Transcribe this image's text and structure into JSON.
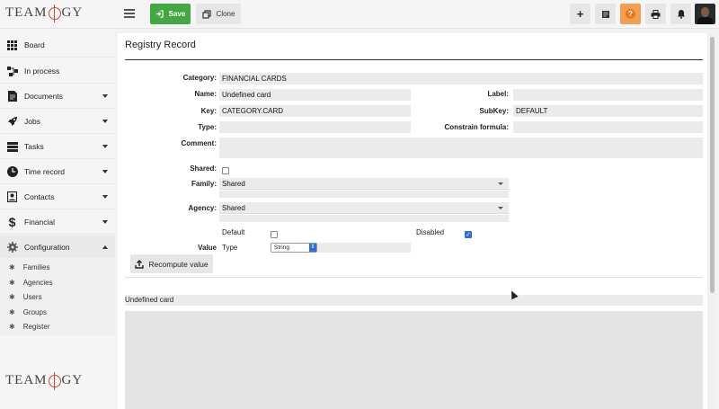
{
  "brand": {
    "logo_left": "TEAM",
    "logo_right": "GY"
  },
  "toolbar": {
    "save_label": "Save",
    "clone_label": "Clone",
    "help_glyph": "?"
  },
  "sidebar": {
    "items": [
      {
        "label": "Board",
        "icon": "grid-icon"
      },
      {
        "label": "In process",
        "icon": "flow-icon"
      },
      {
        "label": "Documents",
        "icon": "document-icon"
      },
      {
        "label": "Jobs",
        "icon": "rocket-icon"
      },
      {
        "label": "Tasks",
        "icon": "tasks-icon"
      },
      {
        "label": "Time record",
        "icon": "clock-icon"
      },
      {
        "label": "Contacts",
        "icon": "contacts-icon"
      },
      {
        "label": "Financial",
        "icon": "dollar-icon"
      },
      {
        "label": "Configuration",
        "icon": "gear-icon"
      }
    ],
    "config_items": [
      {
        "label": "Families"
      },
      {
        "label": "Agencies"
      },
      {
        "label": "Users"
      },
      {
        "label": "Groups"
      },
      {
        "label": "Register"
      }
    ]
  },
  "page": {
    "title": "Registry Record",
    "fields": {
      "category": {
        "label": "Category:",
        "value": "FINANCIAL CARDS"
      },
      "name": {
        "label": "Name:",
        "value": "Undefined card"
      },
      "label": {
        "label": "Label:",
        "value": ""
      },
      "key": {
        "label": "Key:",
        "value": "CATEGORY.CARD"
      },
      "subkey": {
        "label": "SubKey:",
        "value": "DEFAULT"
      },
      "type": {
        "label": "Type:",
        "value": ""
      },
      "constrain": {
        "label": "Constrain formula:",
        "value": ""
      },
      "comment": {
        "label": "Comment:",
        "value": ""
      },
      "shared": {
        "label": "Shared:",
        "checked": false
      },
      "family": {
        "label": "Family:",
        "value": "Shared"
      },
      "agency": {
        "label": "Agency:",
        "value": "Shared"
      },
      "default": {
        "label": "Default",
        "checked": false
      },
      "disabled": {
        "label": "Disabled",
        "checked": true
      },
      "value_label": "Value",
      "value_type_label": "Type",
      "value_type_selected": "String"
    },
    "recompute_label": "Recompute value",
    "preview_title": "Undefined card"
  },
  "colors": {
    "save": "#43a843",
    "accent": "#2c6fd6",
    "logo": "#c94a3b"
  }
}
